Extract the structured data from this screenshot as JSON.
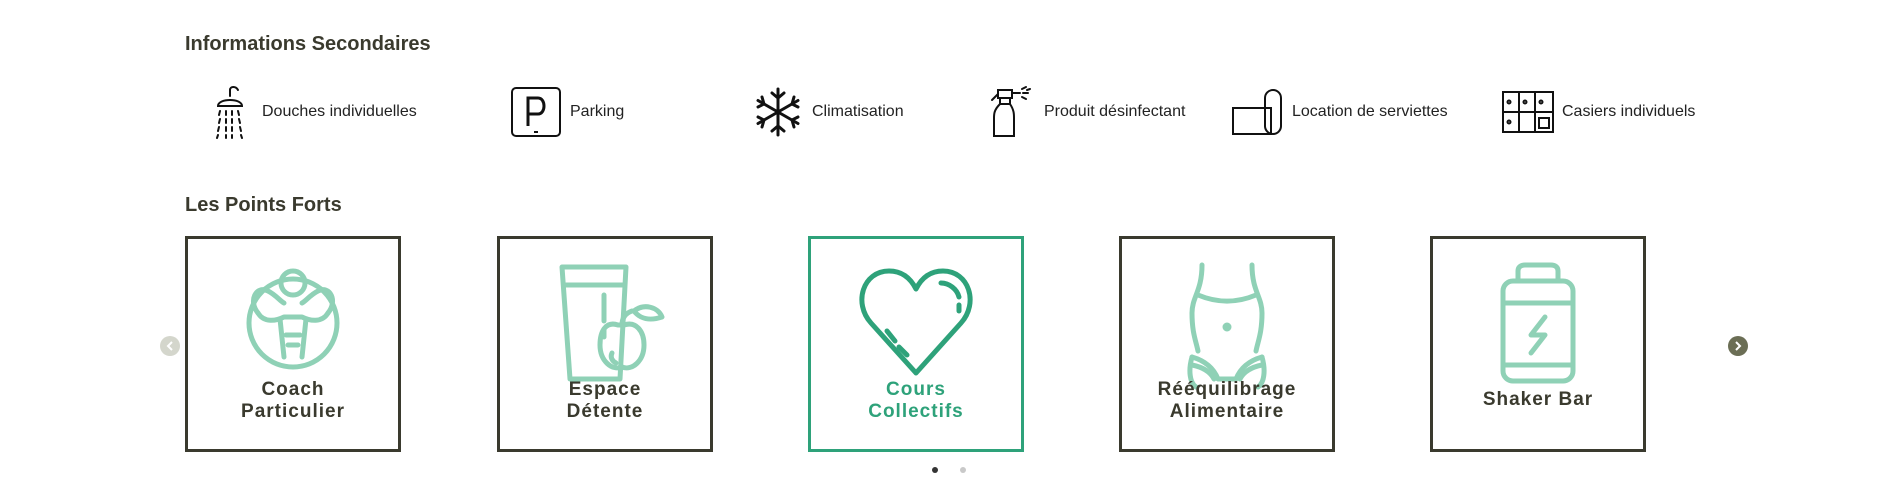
{
  "secondary": {
    "title": "Informations Secondaires",
    "items": [
      {
        "label": "Douches individuelles",
        "icon": "shower-icon"
      },
      {
        "label": "Parking",
        "icon": "parking-icon"
      },
      {
        "label": "Climatisation",
        "icon": "snowflake-icon"
      },
      {
        "label": "Produit désinfectant",
        "icon": "spray-bottle-icon"
      },
      {
        "label": "Location de serviettes",
        "icon": "towel-roll-icon"
      },
      {
        "label": "Casiers individuels",
        "icon": "lockers-icon"
      }
    ]
  },
  "strengths": {
    "title": "Les Points Forts",
    "cards": [
      {
        "label": "Coach\nParticulier",
        "icon": "bodybuilder-icon"
      },
      {
        "label": "Espace\nDétente",
        "icon": "juice-apple-icon"
      },
      {
        "label": "Cours\nCollectifs",
        "icon": "heart-icon"
      },
      {
        "label": "Rééquilibrage\nAlimentaire",
        "icon": "waist-icon"
      },
      {
        "label": "Shaker Bar",
        "icon": "shaker-icon"
      }
    ]
  },
  "colors": {
    "accent": "#2ea27a",
    "accent_light": "#8fd1b6",
    "border": "#3a3a2e"
  }
}
